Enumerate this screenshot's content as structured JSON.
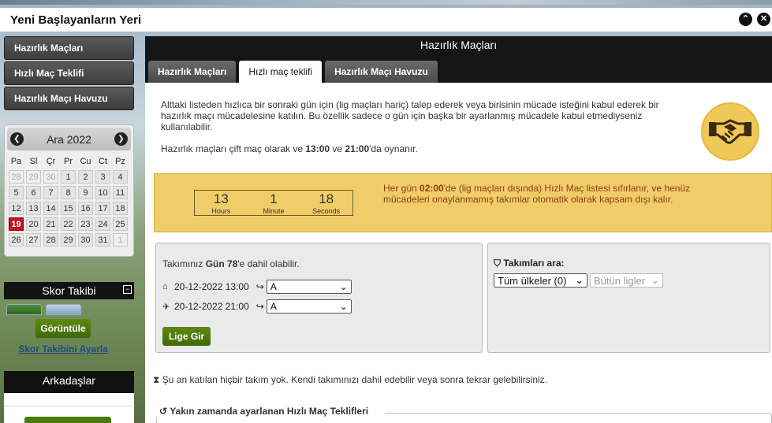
{
  "window": {
    "title": "Yeni Başlayanların Yeri",
    "collapse_glyph": "⌃",
    "close_glyph": "✕"
  },
  "sidebar": {
    "items": [
      {
        "label": "Hazırlık Maçları"
      },
      {
        "label": "Hızlı Maç Teklifi"
      },
      {
        "label": "Hazırlık Maçı Havuzu"
      }
    ]
  },
  "calendar": {
    "month_label": "Ara 2022",
    "prev_glyph": "❮",
    "next_glyph": "❯",
    "weekdays": [
      "Pa",
      "Sl",
      "Çr",
      "Pr",
      "Cu",
      "Ct",
      "Pz"
    ],
    "days": [
      [
        "28",
        "29",
        "30",
        "1",
        "2",
        "3",
        "4"
      ],
      [
        "5",
        "6",
        "7",
        "8",
        "9",
        "10",
        "11"
      ],
      [
        "12",
        "13",
        "14",
        "15",
        "16",
        "17",
        "18"
      ],
      [
        "19",
        "20",
        "21",
        "22",
        "23",
        "24",
        "25"
      ],
      [
        "26",
        "27",
        "28",
        "29",
        "30",
        "31",
        "1"
      ]
    ],
    "today": "19"
  },
  "score_tracking": {
    "title": "Skor Takibi",
    "minimize_glyph": "−",
    "view_button": "Görüntüle",
    "settings_link": "Skor Takibini Ayarla"
  },
  "friends": {
    "title": "Arkadaşlar"
  },
  "main": {
    "header_title": "Hazırlık Maçları",
    "tabs": [
      {
        "label": "Hazırlık Maçları",
        "active": false
      },
      {
        "label": "Hızlı maç teklifi",
        "active": true
      },
      {
        "label": "Hazırlık Maçı Havuzu",
        "active": false
      }
    ],
    "intro_text": "Alttaki listeden hızlıca bir sonraki gün için (lig maçları hariç) talep ederek veya birisinin mücade isteğini kabul ederek bir hazırlık maçı mücadelesine katılın. Bu özellik sadece o gün için başka bir ayarlanmış mücadele kabul etmediyseniz kullanılabilir.",
    "schedule_text_prefix": "Hazırlık maçları çift maç olarak ve ",
    "schedule_time_1": "13:00",
    "schedule_text_mid": " ve ",
    "schedule_time_2": "21:00",
    "schedule_text_suffix": "'da oynanır.",
    "countdown": {
      "hours": "13",
      "hours_label": "Hours",
      "minutes": "1",
      "minutes_label": "Minute",
      "seconds": "18",
      "seconds_label": "Seconds"
    },
    "reset_text_prefix": "Her gün ",
    "reset_time": "02:00",
    "reset_text_suffix": "'de (lig maçları dışında) Hızlı Maç listesi sıfırlanır, ve henüz mücadeleri onaylanmamış takımlar otomatik olarak kapsam dışı kalır.",
    "join_text_prefix": "Takımınız ",
    "team_name": "Gün 78",
    "join_text_suffix": "'e dahil olabilir.",
    "matches": [
      {
        "icon": "home-icon",
        "glyph": "⌂",
        "datetime": "20-12-2022 13:00",
        "selected": "A"
      },
      {
        "icon": "plane-icon",
        "glyph": "✈",
        "datetime": "20-12-2022 21:00",
        "selected": "A"
      }
    ],
    "join_button": "Lige Gir",
    "search_title": "Takımları ara:",
    "country_select": "Tüm ülkeler (0)",
    "league_select": "Bütün ligler",
    "status_text": "Şu an katılan hiçbir takım yok. Kendi takımınızı dahil edebilir veya sonra tekrar gelebilirsiniz.",
    "recent_title": "Yakın zamanda ayarlanan Hızlı Maç Teklifleri"
  },
  "colors": {
    "accent_green": "#4f7c0c",
    "warning_yellow": "#f1cd6a",
    "warning_text": "#8a3e0c",
    "today_red": "#c0151e",
    "link_blue": "#1a4d87"
  }
}
